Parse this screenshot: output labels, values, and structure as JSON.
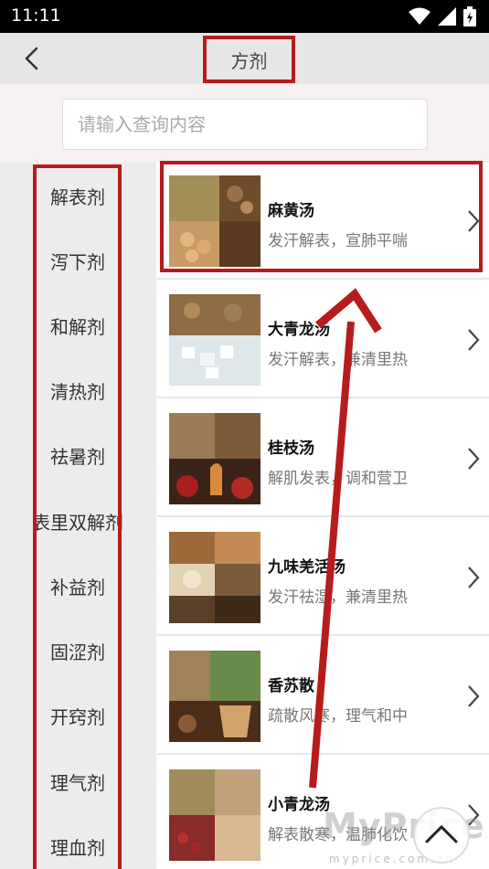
{
  "status_bar": {
    "time": "11:11"
  },
  "header": {
    "title": "方剂"
  },
  "search": {
    "placeholder": "请输入查询内容"
  },
  "categories": [
    {
      "label": "解表剂"
    },
    {
      "label": "泻下剂"
    },
    {
      "label": "和解剂"
    },
    {
      "label": "清热剂"
    },
    {
      "label": "祛暑剂"
    },
    {
      "label": "表里双解剂"
    },
    {
      "label": "补益剂"
    },
    {
      "label": "固涩剂"
    },
    {
      "label": "开窍剂"
    },
    {
      "label": "理气剂"
    },
    {
      "label": "理血剂"
    }
  ],
  "prescriptions": [
    {
      "name": "麻黄汤",
      "desc": "发汗解表，宣肺平喘"
    },
    {
      "name": "大青龙汤",
      "desc": "发汗解表，兼清里热"
    },
    {
      "name": "桂枝汤",
      "desc": "解肌发表，调和营卫"
    },
    {
      "name": "九味羌活汤",
      "desc": "发汗祛湿，兼清里热"
    },
    {
      "name": "香苏散",
      "desc": "疏散风寒，理气和中"
    },
    {
      "name": "小青龙汤",
      "desc": "解表散寒，温肺化饮"
    }
  ],
  "watermark": {
    "main": "MyPrice",
    "sub": "myprice.com.cn"
  },
  "colors": {
    "annotation": "#b71c1c",
    "header_bg": "#e6e6e6",
    "sidebar_bg": "#ececec"
  },
  "icons": [
    "wifi-icon",
    "signal-icon",
    "battery-icon",
    "back-arrow-icon",
    "chevron-right-icon",
    "chevron-up-icon"
  ]
}
